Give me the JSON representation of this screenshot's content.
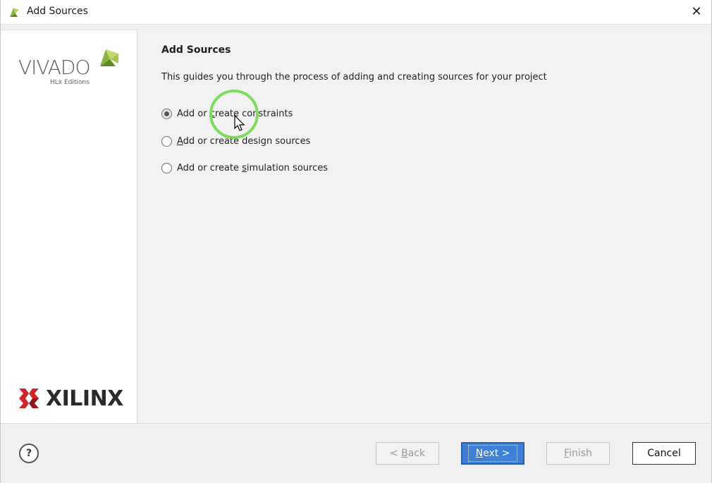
{
  "window": {
    "title": "Add Sources",
    "close_glyph": "✕"
  },
  "sidebar": {
    "vivado_logo_text": "VIVADO",
    "vivado_edition_text": "HLx Editions",
    "xilinx_logo_text": "XILINX",
    "xilinx_registered": "®"
  },
  "main": {
    "heading": "Add Sources",
    "description": "This guides you through the process of adding and creating sources for your project",
    "options": [
      {
        "pre": "Add or ",
        "mnemonic": "c",
        "post": "reate constraints",
        "checked": true
      },
      {
        "pre": "",
        "mnemonic": "A",
        "post": "dd or create design sources",
        "checked": false
      },
      {
        "pre": "Add or create ",
        "mnemonic": "s",
        "post": "imulation sources",
        "checked": false
      }
    ]
  },
  "footer": {
    "help_label": "?",
    "back": {
      "pre": "< ",
      "mnemonic": "B",
      "post": "ack",
      "enabled": false
    },
    "next": {
      "pre": "",
      "mnemonic": "N",
      "post": "ext >",
      "enabled": true
    },
    "finish": {
      "pre": "",
      "mnemonic": "F",
      "post": "inish",
      "enabled": false
    },
    "cancel": {
      "label": "Cancel"
    }
  },
  "icons": {
    "app_icon": "vivado-leaf-icon",
    "close_icon": "close-icon",
    "help_icon": "help-icon",
    "cursor": "mouse-pointer-icon"
  },
  "colors": {
    "primary_button": "#3f7fd6",
    "click_indicator": "#7ddb5e",
    "xilinx_red": "#d2232a",
    "vivado_green": "#8ab63f"
  }
}
